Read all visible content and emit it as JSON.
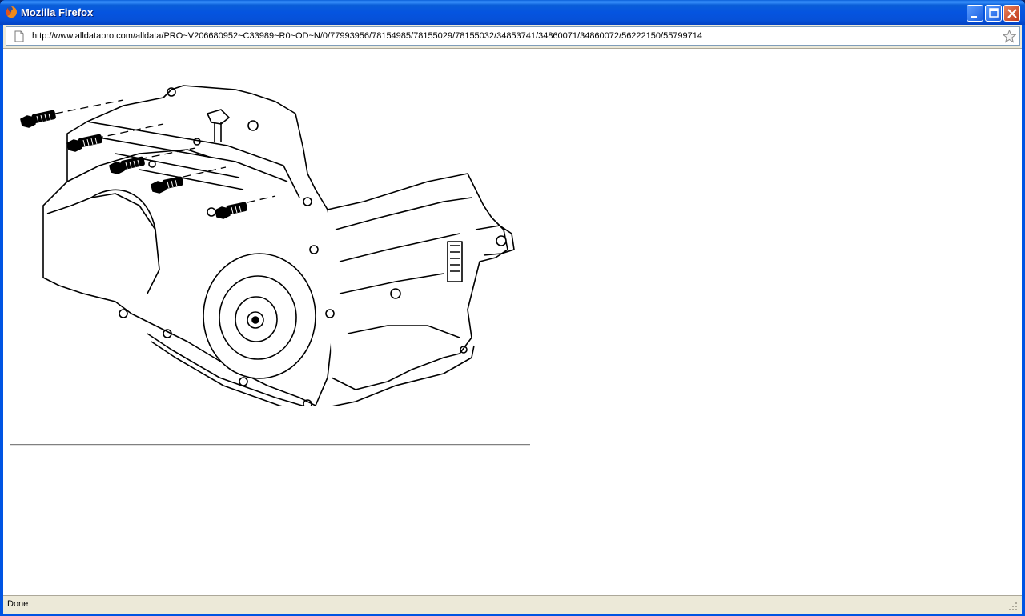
{
  "window": {
    "title": "Mozilla Firefox",
    "controls": [
      "minimize",
      "maximize",
      "close"
    ]
  },
  "urlbar": {
    "url": "http://www.alldatapro.com/alldata/PRO~V206680952~C33989~R0~OD~N/0/77993956/78154985/78155029/78155032/34853741/34860071/34860072/56222150/55799714"
  },
  "content": {
    "figure_icon": "transmission-bolt-illustration"
  },
  "statusbar": {
    "text": "Done"
  },
  "colors": {
    "titlebar": "#0554e0",
    "chrome": "#ece9d8",
    "close_button": "#c0391a"
  }
}
